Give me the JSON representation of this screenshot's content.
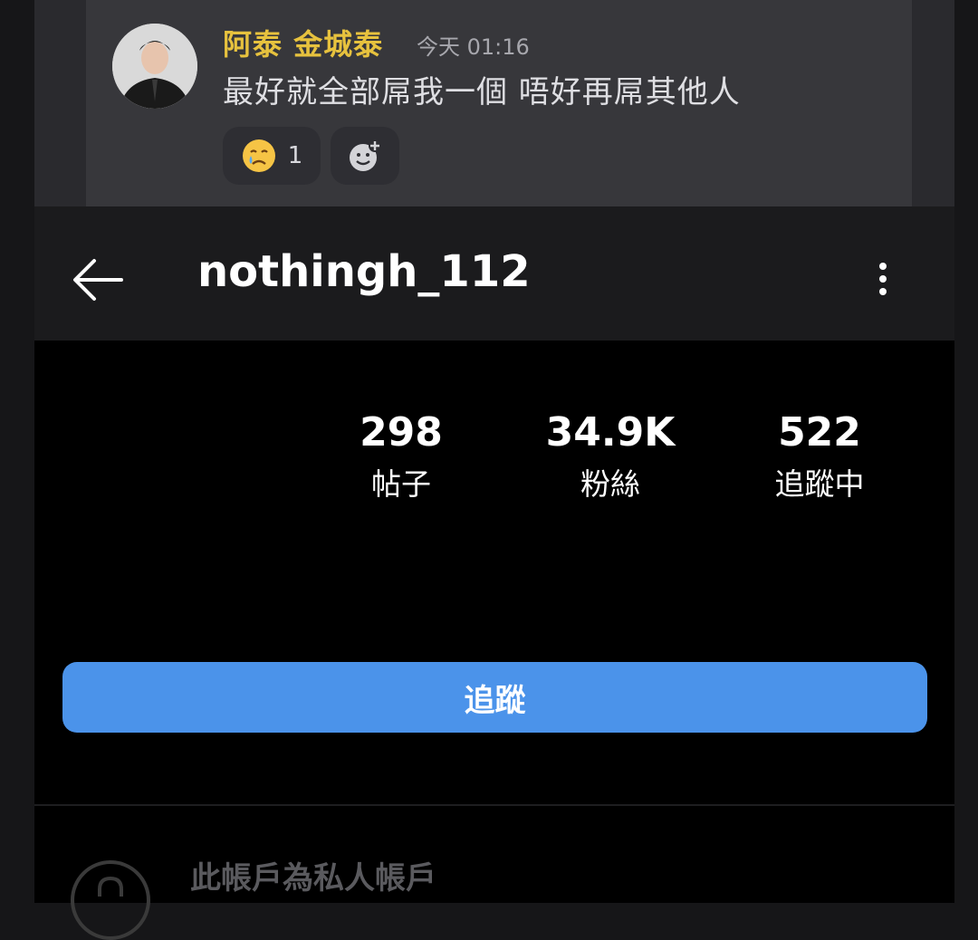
{
  "chat": {
    "author": "阿泰 金城泰",
    "timestamp": "今天 01:16",
    "message": "最好就全部屌我一個 唔好再屌其他人",
    "reactions": [
      {
        "icon": "crying-face-icon",
        "count": "1"
      },
      {
        "icon": "add-reaction-icon"
      }
    ]
  },
  "profile": {
    "username": "nothingh_112",
    "stats": {
      "posts": {
        "value": "298",
        "label": "帖子"
      },
      "followers": {
        "value": "34.9K",
        "label": "粉絲"
      },
      "following": {
        "value": "522",
        "label": "追蹤中"
      }
    },
    "follow_label": "追蹤",
    "private_notice": "此帳戶為私人帳戶"
  },
  "colors": {
    "accent": "#4b93ea",
    "author": "#e7c23e",
    "background": "#000000"
  }
}
